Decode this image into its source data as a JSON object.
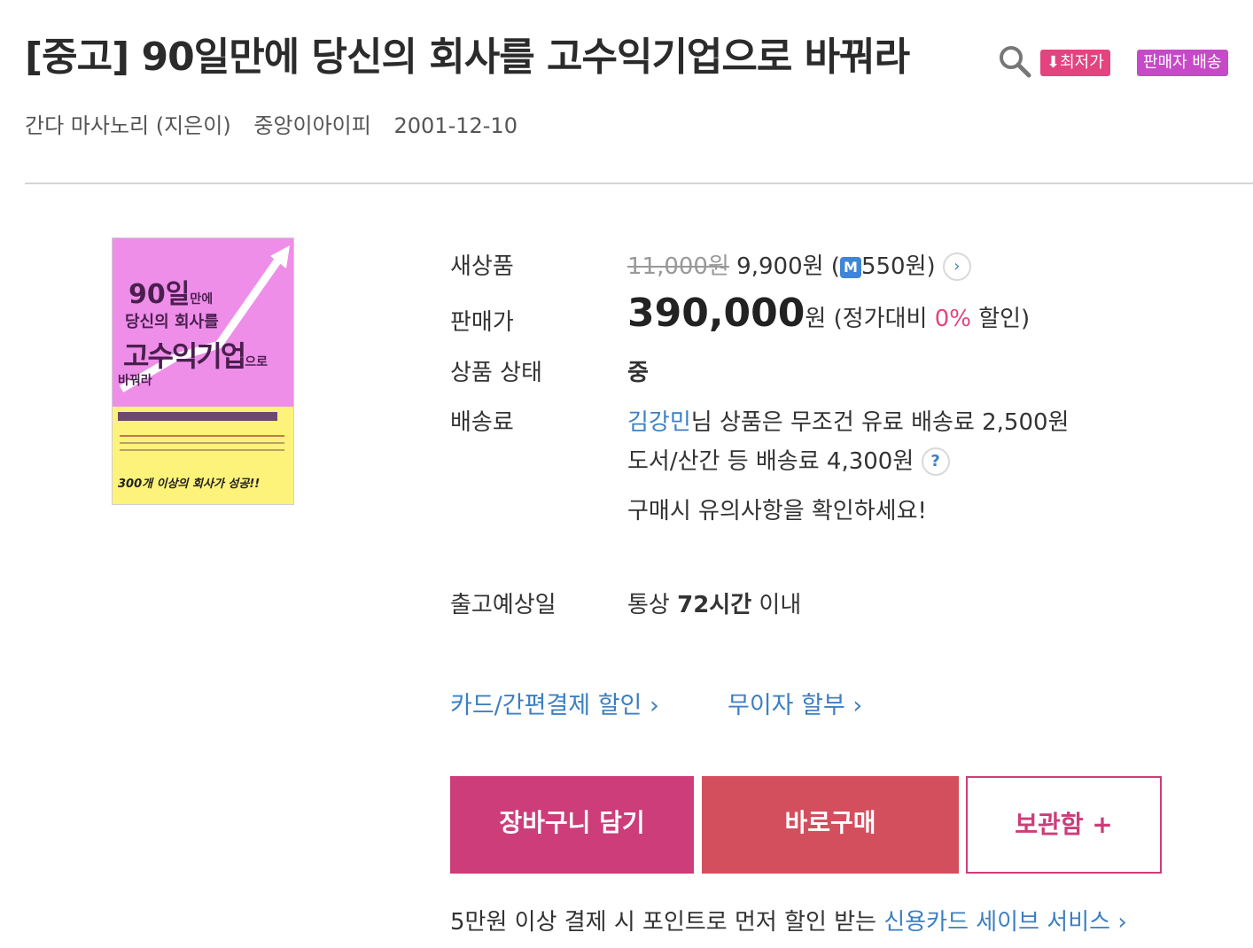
{
  "title": "[중고] 90일만에 당신의 회사를 고수익기업으로 바꿔라",
  "icons": {
    "search": "search-icon",
    "arrow_down": "arrow-down-icon",
    "chevron": "chevron-right-icon",
    "help": "question-icon",
    "mileage": "mileage-icon"
  },
  "badges": {
    "lowest": "최저가",
    "seller": "판매자 배송"
  },
  "meta": {
    "author": "간다 마사노리 (지은이)",
    "publisher": "중앙이아이피",
    "date": "2001-12-10"
  },
  "cover": {
    "line1": "90일",
    "line1b": "만에",
    "line2": "당신의 회사를",
    "line3": "고수익기업",
    "line3b": "으로",
    "line4": "바꿔라",
    "bottom": "300개 이상의 회사가 성공!!",
    "colors": {
      "top": "#ee8ee9",
      "bottom": "#fdf27a"
    }
  },
  "rows": {
    "new_label": "새상품",
    "new_list_price": "11,000원",
    "new_price": "9,900원 (",
    "new_mileage_icon": "M",
    "new_mileage": "550원)",
    "sale_label": "판매가",
    "sale_price": "390,000",
    "sale_unit": "원 (정가대비 ",
    "sale_discount": "0%",
    "sale_suffix": " 할인)",
    "cond_label": "상품 상태",
    "cond_value": "중",
    "ship_label": "배송료",
    "ship_seller": "김강민",
    "ship_line1": "님 상품은 무조건 유료 배송료 2,500원",
    "ship_line2": "도서/산간 등 배송료 4,300원",
    "ship_note": "구매시 유의사항을 확인하세요!",
    "release_label": "출고예상일",
    "release_pre": "통상 ",
    "release_bold": "72시간",
    "release_post": " 이내"
  },
  "links": {
    "card": "카드/간편결제 할인",
    "installment": "무이자 할부"
  },
  "buttons": {
    "cart": "장바구니 담기",
    "buy": "바로구매",
    "keep": "보관함 +"
  },
  "footer": {
    "text": "5만원 이상 결제 시 포인트로 먼저 할인 받는 ",
    "link": "신용카드 세이브 서비스"
  },
  "colors": {
    "accent_pink": "#cc3d7a",
    "buy_red": "#d44f5e",
    "link_blue": "#3d7fc1",
    "badge_pink": "#e3447f",
    "badge_purple": "#c64ac8"
  }
}
